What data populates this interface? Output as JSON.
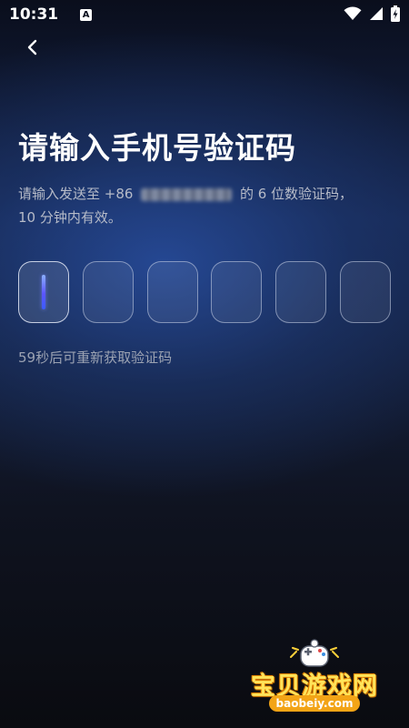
{
  "status_bar": {
    "time": "10:31",
    "notification_letter": "A",
    "icons": [
      "wifi-icon",
      "cellular-signal-icon",
      "battery-charging-icon"
    ]
  },
  "header": {
    "back_icon": "chevron-left-icon"
  },
  "title": "请输入手机号验证码",
  "description": {
    "prefix": "请输入发送至 +86 ",
    "suffix": " 的 6 位数验证码，",
    "line2": "10 分钟内有效。"
  },
  "code_input": {
    "length": 6,
    "active_index": 0,
    "cursor_color": "#5b55ff"
  },
  "resend_text": "59秒后可重新获取验证码",
  "watermark": {
    "brand": "宝贝游戏网",
    "domain": "baobeiy.com"
  },
  "colors": {
    "background_top": "#0a0e1c",
    "background_glow": "#284ea0",
    "text_primary": "#ffffff",
    "text_secondary": "#b6bbc8",
    "watermark_yellow": "#ffe45a",
    "watermark_orange": "#f3a416"
  }
}
